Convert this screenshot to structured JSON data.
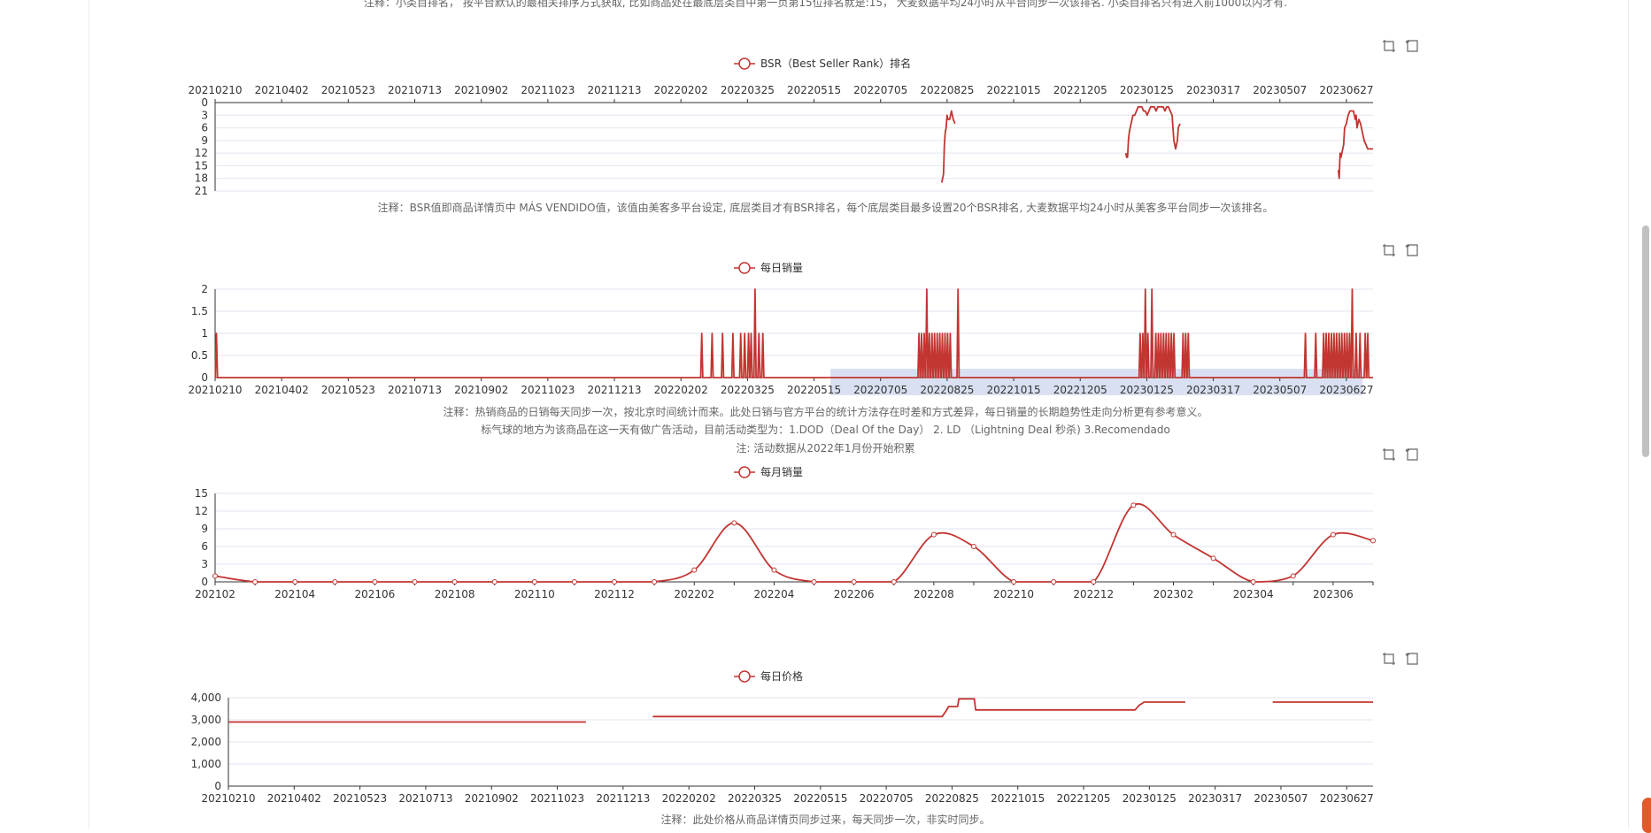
{
  "notes": {
    "top_note": "注释：小类目排名， 按平台默认的最相关排序方式获取, 比如商品处在最底层类目中第一页第15位排名就是:15， 大麦数据平均24小时从平台同步一次该排名. 小类目排名只有进入前1000以内才有.",
    "bsr_note": "注释：BSR值即商品详情页中 MÁS VENDIDO值，该值由美客多平台设定, 底层类目才有BSR排名，每个底层类目最多设置20个BSR排名, 大麦数据平均24小时从美客多平台同步一次该排名。",
    "daily_note_1": "注释：热销商品的日销每天同步一次，按北京时间统计而来。此处日销与官方平台的统计方法存在时差和方式差异，每日销量的长期趋势性走向分析更有参考意义。",
    "daily_note_2": "标气球的地方为该商品在这一天有做广告活动，目前活动类型为：1.DOD（Deal Of the Day） 2. LD （Lightning Deal 秒杀) 3.Recomendado",
    "daily_note_3": "注: 活动数据从2022年1月份开始积累",
    "price_note": "注释：此处价格从商品详情页同步过来，每天同步一次，非实时同步。"
  },
  "toolbox": {
    "zoom_icon": "data-zoom-icon",
    "restore_icon": "restore-icon"
  },
  "colors": {
    "series": "#c23531",
    "axis": "#333333",
    "grid": "#e0e6f1",
    "dataZoom": "#d2dbee"
  },
  "chart_data": [
    {
      "id": "bsr",
      "type": "line",
      "legend": "BSR（Best Seller Rank）排名",
      "x_labels": [
        "20210210",
        "20210402",
        "20210523",
        "20210713",
        "20210902",
        "20211023",
        "20211213",
        "20220202",
        "20220325",
        "20220515",
        "20220705",
        "20220825",
        "20221015",
        "20221205",
        "20230125",
        "20230317",
        "20230507",
        "20230627"
      ],
      "x_axis_position": "top",
      "ylim": [
        0,
        21
      ],
      "y_ticks": [
        0,
        3,
        6,
        9,
        12,
        15,
        18,
        21
      ],
      "y_inverse": true,
      "x_range": [
        0,
        890
      ],
      "segments": [
        [
          [
            817,
            19
          ],
          [
            818,
            18
          ],
          [
            819,
            17
          ],
          [
            820,
            10
          ],
          [
            821,
            7
          ],
          [
            822,
            6
          ],
          [
            823,
            3
          ],
          [
            824,
            4
          ],
          [
            826,
            4
          ],
          [
            828,
            2
          ],
          [
            829,
            3
          ],
          [
            830,
            4
          ],
          [
            832,
            5
          ]
        ],
        [
          [
            1024,
            12
          ],
          [
            1025,
            13
          ],
          [
            1026,
            13
          ],
          [
            1027,
            9
          ],
          [
            1028,
            7
          ],
          [
            1029,
            6
          ],
          [
            1030,
            5
          ],
          [
            1032,
            3
          ],
          [
            1034,
            3
          ],
          [
            1036,
            2
          ],
          [
            1038,
            1
          ],
          [
            1040,
            1
          ],
          [
            1042,
            1
          ],
          [
            1044,
            2
          ],
          [
            1046,
            2
          ],
          [
            1048,
            3
          ],
          [
            1050,
            2
          ],
          [
            1052,
            1
          ],
          [
            1054,
            1
          ],
          [
            1056,
            1
          ],
          [
            1058,
            2
          ],
          [
            1060,
            1
          ],
          [
            1062,
            1
          ],
          [
            1064,
            1
          ],
          [
            1066,
            1
          ],
          [
            1068,
            2
          ],
          [
            1070,
            1
          ],
          [
            1072,
            1
          ],
          [
            1074,
            2
          ],
          [
            1076,
            3
          ],
          [
            1078,
            9
          ],
          [
            1079,
            10
          ],
          [
            1080,
            11
          ],
          [
            1082,
            9
          ],
          [
            1083,
            6
          ],
          [
            1085,
            5
          ]
        ],
        [
          [
            1263,
            16
          ],
          [
            1264,
            18
          ],
          [
            1265,
            12
          ],
          [
            1266,
            13
          ],
          [
            1268,
            11
          ],
          [
            1269,
            10
          ],
          [
            1270,
            6
          ],
          [
            1272,
            5
          ],
          [
            1274,
            3
          ],
          [
            1276,
            2
          ],
          [
            1278,
            2
          ],
          [
            1280,
            2
          ],
          [
            1282,
            4
          ],
          [
            1283,
            3
          ],
          [
            1284,
            6
          ],
          [
            1286,
            4
          ],
          [
            1288,
            5
          ],
          [
            1290,
            7
          ],
          [
            1292,
            9
          ],
          [
            1294,
            10
          ],
          [
            1296,
            11
          ],
          [
            1298,
            11
          ],
          [
            1300,
            11
          ],
          [
            1302,
            11
          ]
        ]
      ]
    },
    {
      "id": "daily_sales",
      "type": "line",
      "legend": "每日销量",
      "x_labels": [
        "20210210",
        "20210402",
        "20210523",
        "20210713",
        "20210902",
        "20211023",
        "20211213",
        "20220202",
        "20220325",
        "20220515",
        "20220705",
        "20220825",
        "20221015",
        "20221205",
        "20230125",
        "20230317",
        "20230507",
        "20230627"
      ],
      "x_axis_position": "bottom",
      "ylim": [
        0,
        2
      ],
      "y_ticks": [
        0,
        0.5,
        1,
        1.5,
        2
      ],
      "y_labels": [
        "0",
        "0.5",
        "1",
        "1.5",
        "2"
      ],
      "spikes": [
        {
          "day": 1,
          "value": 1
        },
        {
          "day": 374,
          "value": 1
        },
        {
          "day": 382,
          "value": 1
        },
        {
          "day": 390,
          "value": 1
        },
        {
          "day": 398,
          "value": 1
        },
        {
          "day": 404,
          "value": 1
        },
        {
          "day": 407,
          "value": 1
        },
        {
          "day": 410,
          "value": 1
        },
        {
          "day": 412,
          "value": 1
        },
        {
          "day": 415,
          "value": 2
        },
        {
          "day": 418,
          "value": 1
        },
        {
          "day": 421,
          "value": 1
        },
        {
          "day": 541,
          "value": 1
        },
        {
          "day": 543,
          "value": 1
        },
        {
          "day": 545,
          "value": 1
        },
        {
          "day": 547,
          "value": 2
        },
        {
          "day": 549,
          "value": 1
        },
        {
          "day": 551,
          "value": 1
        },
        {
          "day": 553,
          "value": 1
        },
        {
          "day": 555,
          "value": 1
        },
        {
          "day": 557,
          "value": 1
        },
        {
          "day": 559,
          "value": 1
        },
        {
          "day": 561,
          "value": 1
        },
        {
          "day": 563,
          "value": 1
        },
        {
          "day": 565,
          "value": 1
        },
        {
          "day": 571,
          "value": 2
        },
        {
          "day": 711,
          "value": 1
        },
        {
          "day": 713,
          "value": 1
        },
        {
          "day": 715,
          "value": 2
        },
        {
          "day": 717,
          "value": 1
        },
        {
          "day": 720,
          "value": 2
        },
        {
          "day": 723,
          "value": 1
        },
        {
          "day": 725,
          "value": 1
        },
        {
          "day": 727,
          "value": 1
        },
        {
          "day": 729,
          "value": 1
        },
        {
          "day": 731,
          "value": 1
        },
        {
          "day": 733,
          "value": 1
        },
        {
          "day": 735,
          "value": 1
        },
        {
          "day": 737,
          "value": 1
        },
        {
          "day": 744,
          "value": 1
        },
        {
          "day": 746,
          "value": 1
        },
        {
          "day": 748,
          "value": 1
        },
        {
          "day": 838,
          "value": 1
        },
        {
          "day": 846,
          "value": 1
        },
        {
          "day": 852,
          "value": 1
        },
        {
          "day": 854,
          "value": 1
        },
        {
          "day": 856,
          "value": 1
        },
        {
          "day": 858,
          "value": 1
        },
        {
          "day": 860,
          "value": 1
        },
        {
          "day": 862,
          "value": 1
        },
        {
          "day": 864,
          "value": 1
        },
        {
          "day": 866,
          "value": 1
        },
        {
          "day": 868,
          "value": 1
        },
        {
          "day": 870,
          "value": 1
        },
        {
          "day": 872,
          "value": 1
        },
        {
          "day": 874,
          "value": 2
        },
        {
          "day": 877,
          "value": 1
        },
        {
          "day": 880,
          "value": 1
        },
        {
          "day": 884,
          "value": 1
        },
        {
          "day": 886,
          "value": 1
        }
      ],
      "x_range": [
        0,
        890
      ],
      "data_zoom": {
        "start_day": 473,
        "end_day": 882
      }
    },
    {
      "id": "monthly_sales",
      "type": "line",
      "legend": "每月销量",
      "categories": [
        "202102",
        "202103",
        "202104",
        "202105",
        "202106",
        "202107",
        "202108",
        "202109",
        "202110",
        "202111",
        "202112",
        "202201",
        "202202",
        "202203",
        "202204",
        "202205",
        "202206",
        "202207",
        "202208",
        "202209",
        "202210",
        "202211",
        "202212",
        "202301",
        "202302",
        "202303",
        "202304",
        "202305",
        "202306",
        "202307"
      ],
      "x_labels": [
        "202102",
        "202104",
        "202106",
        "202108",
        "202110",
        "202112",
        "202202",
        "202204",
        "202206",
        "202208",
        "202210",
        "202212",
        "202302",
        "202304",
        "202306"
      ],
      "values": [
        1,
        0,
        0,
        0,
        0,
        0,
        0,
        0,
        0,
        0,
        0,
        0,
        2,
        10,
        2,
        0,
        0,
        0,
        8,
        6,
        0,
        0,
        0,
        13,
        8,
        4,
        0,
        1,
        8,
        7
      ],
      "ylim": [
        0,
        15
      ],
      "y_ticks": [
        0,
        3,
        6,
        9,
        12,
        15
      ],
      "smooth": true
    },
    {
      "id": "daily_price",
      "type": "line",
      "legend": "每日价格",
      "x_labels": [
        "20210210",
        "20210402",
        "20210523",
        "20210713",
        "20210902",
        "20211023",
        "20211213",
        "20220202",
        "20220325",
        "20220515",
        "20220705",
        "20220825",
        "20221015",
        "20221205",
        "20230125",
        "20230317",
        "20230507",
        "20230627"
      ],
      "ylim": [
        0,
        4000
      ],
      "y_ticks": [
        0,
        1000,
        2000,
        3000,
        4000
      ],
      "y_labels": [
        "0",
        "1,000",
        "2,000",
        "3,000",
        "4,000"
      ],
      "x_range": [
        0,
        890
      ],
      "segments": [
        [
          [
            0,
            2900
          ],
          [
            278,
            2900
          ]
        ],
        [
          [
            330,
            3150
          ],
          [
            555,
            3150
          ],
          [
            558,
            3400
          ],
          [
            560,
            3600
          ],
          [
            567,
            3600
          ],
          [
            568,
            3950
          ],
          [
            580,
            3950
          ],
          [
            581,
            3450
          ],
          [
            705,
            3450
          ],
          [
            708,
            3650
          ],
          [
            712,
            3800
          ],
          [
            744,
            3800
          ]
        ],
        [
          [
            812,
            3800
          ],
          [
            890,
            3800
          ]
        ]
      ]
    }
  ]
}
